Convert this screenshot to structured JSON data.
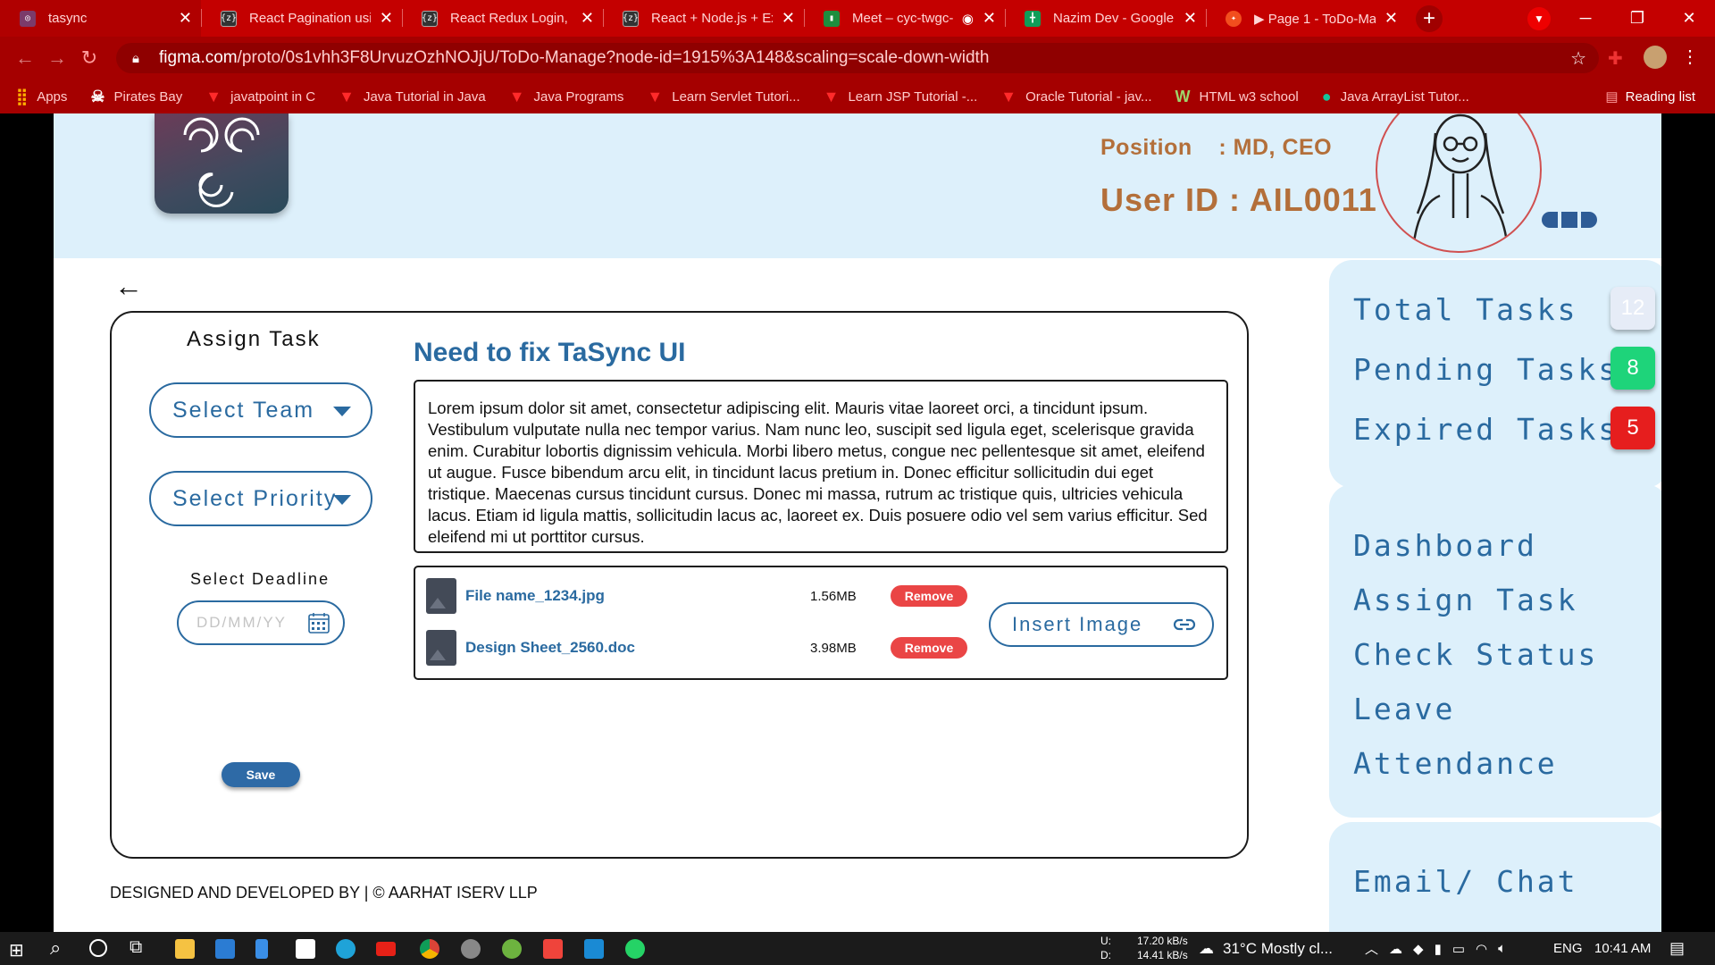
{
  "browser": {
    "tabs": [
      {
        "title": "tasync",
        "icon": "figma-tasync-icon",
        "color": "#7b3b6a",
        "active": true
      },
      {
        "title": "React Pagination usin",
        "icon": "codesandbox-icon",
        "color": "#333333"
      },
      {
        "title": "React Redux Login, Lo",
        "icon": "codesandbox-icon",
        "color": "#333333"
      },
      {
        "title": "React + Node.js + Exp",
        "icon": "codesandbox-icon",
        "color": "#333333"
      },
      {
        "title": "Meet – cyc-twgc-",
        "icon": "meet-icon",
        "color": "#1e8e3e"
      },
      {
        "title": "Nazim Dev - Google S",
        "icon": "sheets-icon",
        "color": "#0f9d58"
      },
      {
        "title": "▶ Page 1 - ToDo-Ma",
        "icon": "figma-icon",
        "color": "#f24e1e"
      }
    ],
    "url_host": "figma.com",
    "url_path": "/proto/0s1vhh3F8UrvuzOzhNOJjU/ToDo-Manage?node-id=1915%3A148&scaling=scale-down-width",
    "bookmarks": [
      {
        "label": "Apps",
        "icon": "apps-grid-icon"
      },
      {
        "label": "Pirates Bay",
        "icon": "pirate-icon"
      },
      {
        "label": "javatpoint in C",
        "icon": "vivaldi-icon"
      },
      {
        "label": "Java Tutorial in Java",
        "icon": "vivaldi-icon"
      },
      {
        "label": "Java Programs",
        "icon": "vivaldi-icon"
      },
      {
        "label": "Learn Servlet Tutori...",
        "icon": "vivaldi-icon"
      },
      {
        "label": "Learn JSP Tutorial -...",
        "icon": "vivaldi-icon"
      },
      {
        "label": "Oracle Tutorial - jav...",
        "icon": "vivaldi-icon"
      },
      {
        "label": "HTML w3 school",
        "icon": "w3-icon"
      },
      {
        "label": "Java ArrayList Tutor...",
        "icon": "grammarly-icon"
      }
    ],
    "reading_list": "Reading list"
  },
  "header": {
    "position_label": "Position",
    "position_value": ": MD, CEO",
    "user_id": "User ID : AIL0011"
  },
  "form": {
    "section_title": "Assign Task",
    "select_team": "Select Team",
    "select_priority": "Select Priority",
    "deadline_label": "Select Deadline",
    "deadline_placeholder": "DD/MM/YY",
    "save": "Save"
  },
  "task": {
    "title": "Need to fix TaSync UI",
    "description": " Lorem ipsum dolor sit amet, consectetur adipiscing elit. Mauris vitae laoreet orci, a tincidunt ipsum. Vestibulum vulputate nulla nec tempor varius. Nam nunc leo, suscipit sed ligula eget, scelerisque gravida enim. Curabitur lobortis dignissim vehicula. Morbi libero metus, congue nec pellentesque sit amet, eleifend ut augue. Fusce bibendum arcu elit, in tincidunt lacus pretium in. Donec efficitur sollicitudin dui eget tristique. Maecenas cursus tincidunt cursus. Donec mi massa, rutrum ac tristique quis, ultricies vehicula lacus. Etiam id ligula mattis, sollicitudin lacus ac, laoreet ex. Duis posuere odio vel sem varius efficitur. Sed eleifend mi ut porttitor cursus.",
    "files": [
      {
        "name": "File name_1234.jpg",
        "size": "1.56MB",
        "action": "Remove"
      },
      {
        "name": "Design Sheet_2560.doc",
        "size": "3.98MB",
        "action": "Remove"
      }
    ],
    "insert_image": "Insert Image"
  },
  "stats": [
    {
      "label": "Total Tasks",
      "count": "12",
      "color": "#e6ecf7"
    },
    {
      "label": "Pending Tasks",
      "count": "8",
      "color": "#1ed47a"
    },
    {
      "label": "Expired Tasks",
      "count": "5",
      "color": "#e61e1e"
    }
  ],
  "nav": [
    "Dashboard",
    "Assign Task",
    "Check Status",
    "Leave",
    "Attendance"
  ],
  "email_chat": "Email/ Chat",
  "footer": "DESIGNED AND DEVELOPED BY | © AARHAT ISERV LLP",
  "taskbar": {
    "net_up_label": "U:",
    "net_down_label": "D:",
    "net_up": "17.20 kB/s",
    "net_down": "14.41 kB/s",
    "weather": "31°C  Mostly cl...",
    "lang": "ENG",
    "time": "10:41 AM"
  }
}
